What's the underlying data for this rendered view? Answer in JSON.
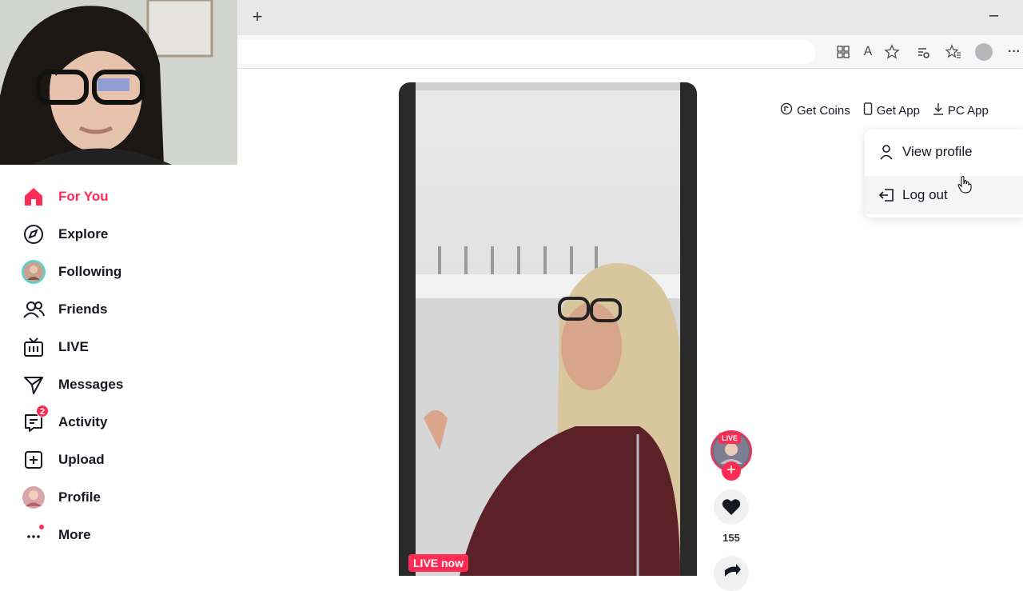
{
  "browser": {
    "new_tab_glyph": "+",
    "minimize_glyph": "–",
    "toolbar_icons": [
      "apps-icon",
      "read-aloud-icon",
      "favorite-star-icon",
      "extensions-icon",
      "favorites-icon",
      "profile-icon",
      "more-icon"
    ],
    "read_aloud_label": "A",
    "more_glyph": "···"
  },
  "sidebar": {
    "items": [
      {
        "label": "For You",
        "icon": "home-icon",
        "active": true
      },
      {
        "label": "Explore",
        "icon": "compass-icon"
      },
      {
        "label": "Following",
        "icon": "following-avatar"
      },
      {
        "label": "Friends",
        "icon": "friends-icon"
      },
      {
        "label": "LIVE",
        "icon": "live-tv-icon"
      },
      {
        "label": "Messages",
        "icon": "send-icon"
      },
      {
        "label": "Activity",
        "icon": "activity-icon",
        "badge": "2"
      },
      {
        "label": "Upload",
        "icon": "upload-icon"
      },
      {
        "label": "Profile",
        "icon": "profile-avatar"
      },
      {
        "label": "More",
        "icon": "more-dots-icon"
      }
    ]
  },
  "header": {
    "get_coins": "Get Coins",
    "get_app": "Get App",
    "pc_app": "PC App"
  },
  "dropdown": {
    "view_profile": "View profile",
    "log_out": "Log out"
  },
  "video": {
    "live_now": "LIVE now",
    "live_tag": "LIVE",
    "follow_plus": "+",
    "like_count": "155"
  },
  "colors": {
    "accent": "#fe2c55",
    "text": "#161823"
  }
}
